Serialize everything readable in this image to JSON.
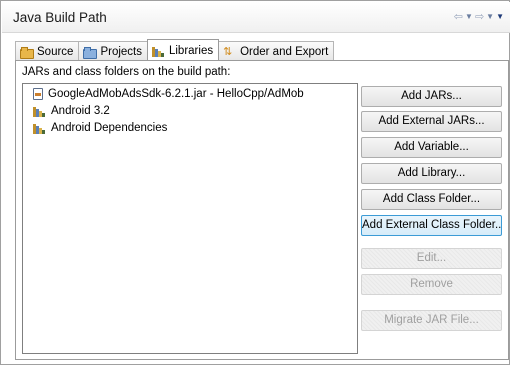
{
  "header": {
    "title": "Java Build Path"
  },
  "nav": {
    "back_icon": "back-arrow-icon",
    "forward_icon": "forward-arrow-icon",
    "menu_icon": "view-menu-icon"
  },
  "tabs": [
    {
      "label": "Source",
      "icon": "source-folder-icon",
      "active": false
    },
    {
      "label": "Projects",
      "icon": "projects-folder-icon",
      "active": false
    },
    {
      "label": "Libraries",
      "icon": "libraries-icon",
      "active": true
    },
    {
      "label": "Order and Export",
      "icon": "order-export-icon",
      "active": false
    }
  ],
  "panel": {
    "label": "JARs and class folders on the build path:",
    "entries": [
      {
        "label": "GoogleAdMobAdsSdk-6.2.1.jar - HelloCpp/AdMob",
        "icon": "jar-icon"
      },
      {
        "label": "Android 3.2",
        "icon": "library-icon"
      },
      {
        "label": "Android Dependencies",
        "icon": "library-icon"
      }
    ]
  },
  "buttons": {
    "add_jars": "Add JARs...",
    "add_external_jars": "Add External JARs...",
    "add_variable": "Add Variable...",
    "add_library": "Add Library...",
    "add_class_folder": "Add Class Folder...",
    "add_external_class_folder": "Add External Class Folder...",
    "edit": "Edit...",
    "remove": "Remove",
    "migrate_jar": "Migrate JAR File..."
  },
  "colors": {
    "focus_border": "#3c9bd6",
    "disabled_text": "#9f9f9f"
  }
}
